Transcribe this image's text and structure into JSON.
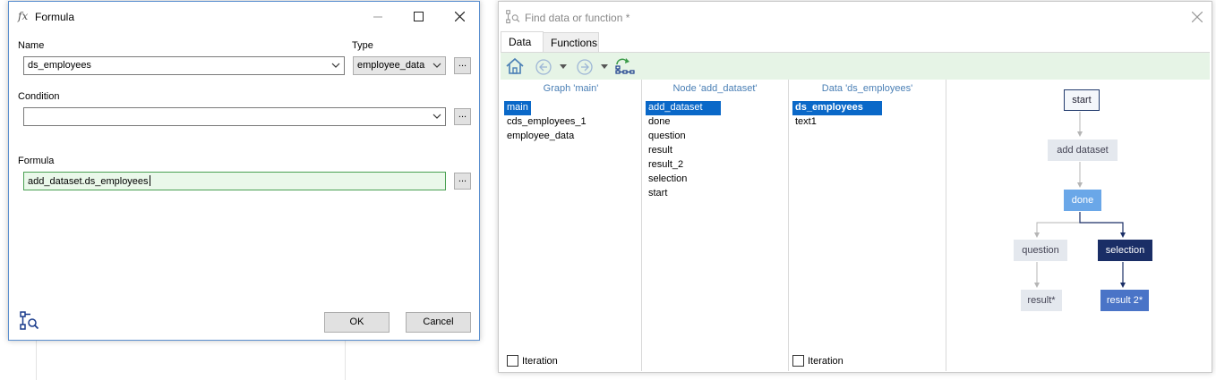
{
  "formula_dialog": {
    "title": "Formula",
    "fx_glyph": "fx",
    "name_label": "Name",
    "name_value": "ds_employees",
    "type_label": "Type",
    "type_value": "employee_data",
    "condition_label": "Condition",
    "condition_value": "",
    "formula_label": "Formula",
    "formula_value": "add_dataset.ds_employees",
    "browse_label": "...",
    "ok_label": "OK",
    "cancel_label": "Cancel"
  },
  "find_dialog": {
    "title": "Find data or function *",
    "tabs": [
      "Data",
      "Functions"
    ],
    "graph_panel": {
      "header": "Graph 'main'",
      "items": [
        "main",
        "cds_employees_1",
        "employee_data"
      ],
      "selected": "main",
      "iteration_label": "Iteration"
    },
    "node_panel": {
      "header": "Node 'add_dataset'",
      "items": [
        "add_dataset",
        "done",
        "question",
        "result",
        "result_2",
        "selection",
        "start"
      ],
      "selected": "add_dataset"
    },
    "data_panel": {
      "header": "Data 'ds_employees'",
      "items": [
        "ds_employees",
        "text1"
      ],
      "selected": "ds_employees",
      "iteration_label": "Iteration"
    },
    "graph_nodes": {
      "start": "start",
      "add_dataset": "add dataset",
      "done": "done",
      "question": "question",
      "selection": "selection",
      "result": "result*",
      "result_2": "result 2*"
    }
  },
  "colors": {
    "selection_blue": "#0a68c8",
    "toolbar_green": "#e6f4e6",
    "node_dark": "#1a2e66",
    "node_light_blue": "#6aa7e8",
    "node_mid_blue": "#4a74c7",
    "header_blue": "#4a7fb5"
  },
  "icons": [
    "fx-icon",
    "minimize-icon",
    "maximize-icon",
    "close-icon",
    "chevron-down-icon",
    "graph-search-icon",
    "home-icon",
    "back-icon",
    "forward-icon",
    "graph-tree-icon"
  ]
}
